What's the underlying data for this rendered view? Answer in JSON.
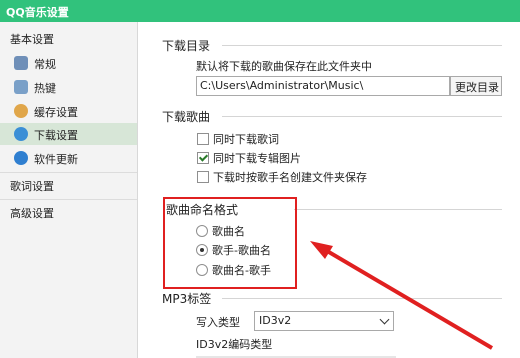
{
  "window": {
    "title": "QQ音乐设置"
  },
  "sidebar": {
    "basic_header": "基本设置",
    "items": [
      {
        "label": "常规",
        "icon": "general-icon",
        "active": false
      },
      {
        "label": "热键",
        "icon": "hotkey-icon",
        "active": false
      },
      {
        "label": "缓存设置",
        "icon": "cache-icon",
        "active": false
      },
      {
        "label": "下载设置",
        "icon": "download-icon",
        "active": true
      },
      {
        "label": "软件更新",
        "icon": "update-icon",
        "active": false
      }
    ],
    "lyrics_header": "歌词设置",
    "advanced_header": "高级设置"
  },
  "download_dir": {
    "title": "下载目录",
    "desc": "默认将下载的歌曲保存在此文件夹中",
    "path": "C:\\Users\\Administrator\\Music\\",
    "change_button": "更改目录"
  },
  "download_songs": {
    "title": "下载歌曲",
    "options": [
      {
        "label": "同时下载歌词",
        "checked": false
      },
      {
        "label": "同时下载专辑图片",
        "checked": true
      },
      {
        "label": "下载时按歌手名创建文件夹保存",
        "checked": false
      }
    ]
  },
  "naming_format": {
    "title": "歌曲命名格式",
    "options": [
      {
        "label": "歌曲名",
        "selected": false
      },
      {
        "label": "歌手-歌曲名",
        "selected": true
      },
      {
        "label": "歌曲名-歌手",
        "selected": false
      }
    ]
  },
  "mp3_tags": {
    "title": "MP3标签",
    "write_type_label": "写入类型",
    "write_type_value": "ID3v2",
    "encoding_label": "ID3v2编码类型"
  },
  "colors": {
    "title_bar": "#31c27c",
    "highlight_box": "#e02020",
    "active_item": "#d7e6d7"
  }
}
